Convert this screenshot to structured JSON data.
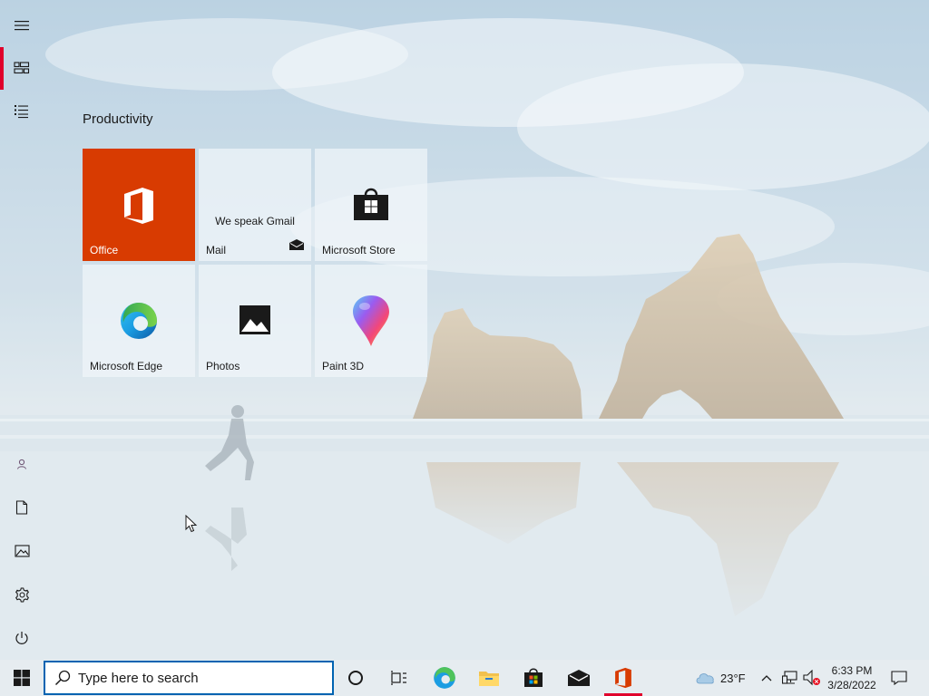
{
  "start_menu": {
    "group_title": "Productivity",
    "tiles": [
      {
        "id": "office",
        "label": "Office"
      },
      {
        "id": "mail",
        "label": "Mail",
        "live_text": "We speak Gmail"
      },
      {
        "id": "store",
        "label": "Microsoft Store"
      },
      {
        "id": "edge",
        "label": "Microsoft Edge"
      },
      {
        "id": "photos",
        "label": "Photos"
      },
      {
        "id": "paint3d",
        "label": "Paint 3D"
      }
    ],
    "rail_icons": [
      "hamburger-menu-icon",
      "all-tiles-icon",
      "app-list-icon",
      "user-icon",
      "document-icon",
      "pictures-icon",
      "settings-icon",
      "power-icon"
    ],
    "accent_color": "#e0002b",
    "office_tile_color": "#d83b01"
  },
  "taskbar": {
    "search": {
      "placeholder": "Type here to search"
    },
    "pinned_icons": [
      "start-icon",
      "cortana-icon",
      "task-view-icon",
      "edge-icon",
      "file-explorer-icon",
      "store-icon",
      "mail-icon",
      "office-icon"
    ],
    "active_app": "office",
    "weather": {
      "temperature": "23°F",
      "icon": "cloud-icon"
    },
    "tray_icons": [
      "chevron-up-icon",
      "network-icon",
      "volume-muted-icon"
    ],
    "clock": {
      "time": "6:33 PM",
      "date": "3/28/2022"
    },
    "notification_icon": "action-center-icon"
  }
}
